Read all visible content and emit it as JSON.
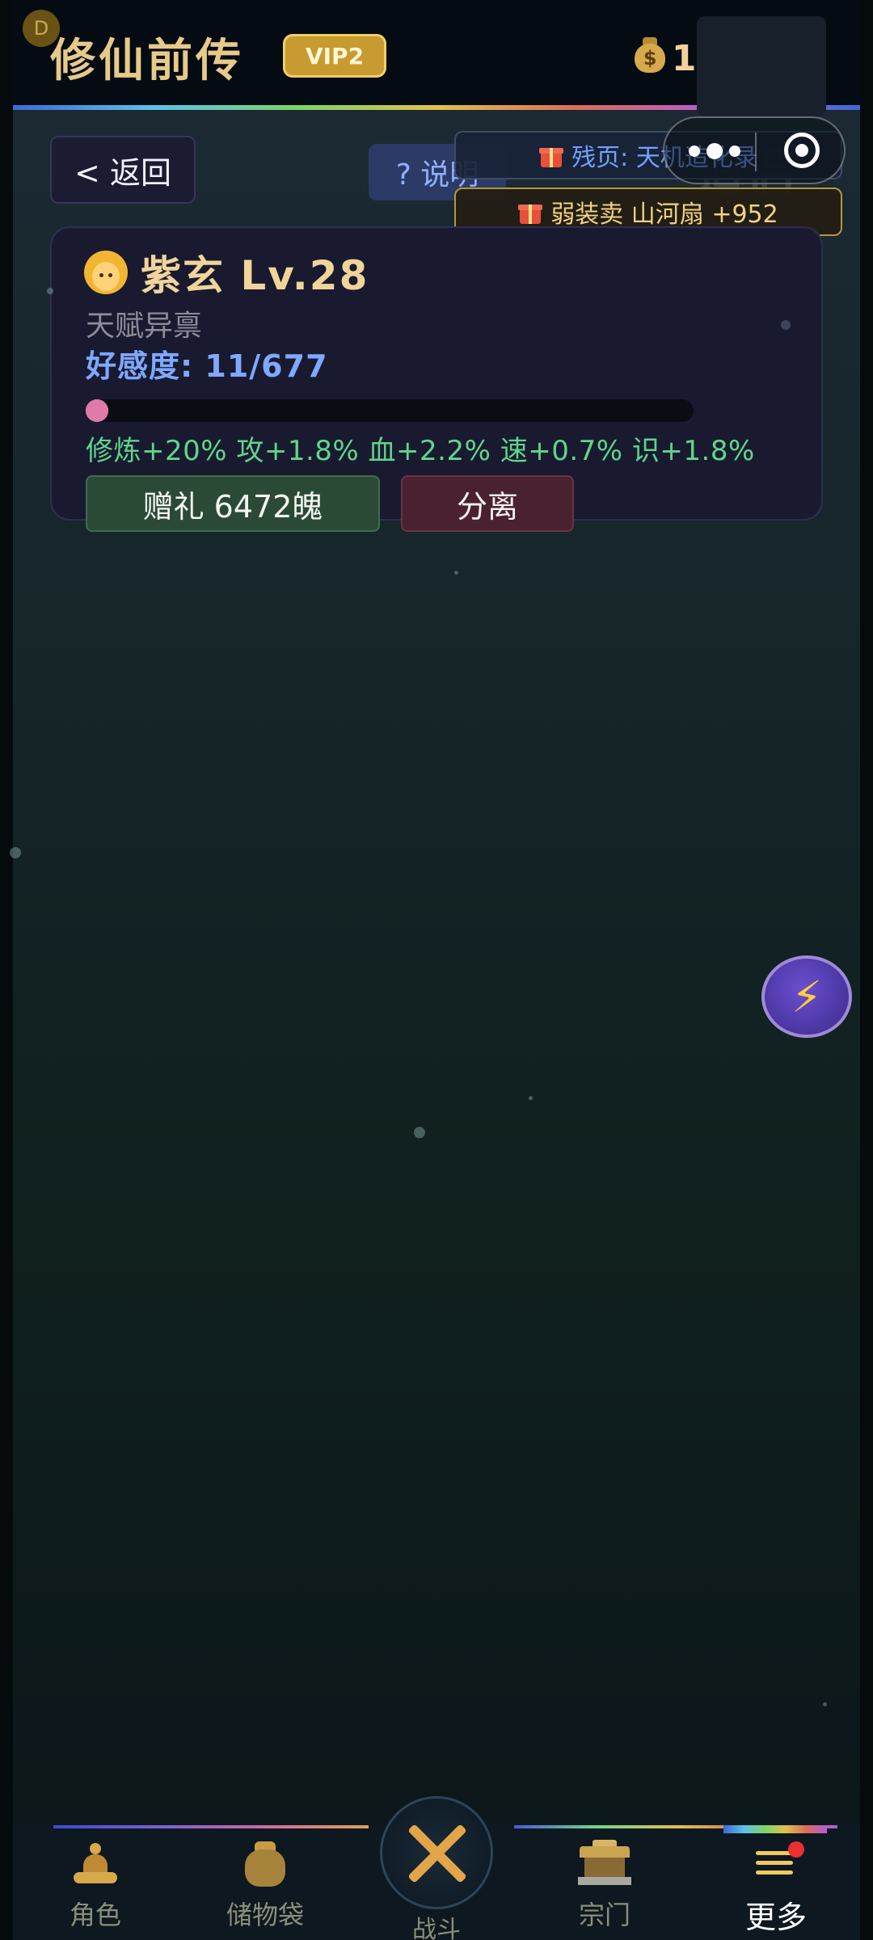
{
  "header": {
    "badge_letter": "D",
    "title": "修仙前传",
    "vip": "VIP2",
    "currency_amount": "183.2万",
    "currency_icon": "money-bag-icon"
  },
  "toolbar": {
    "back_label": "< 返回",
    "help_label": "? 说明",
    "ghost_title": "道侣"
  },
  "tickers": [
    {
      "text": "残页: 天机造化录",
      "color": "#6fa2ff"
    },
    {
      "text": "弱装卖 山河扇 +952",
      "color": "#f3d27f"
    }
  ],
  "companion": {
    "name": "紫玄 Lv.28",
    "talent": "天赋异禀",
    "affinity": "好感度: 11/677",
    "affinity_current": 11,
    "affinity_max": 677,
    "bonuses": "修炼+20% 攻+1.8% 血+2.2% 速+0.7% 识+1.8%",
    "gift_label": "赠礼 6472魄",
    "split_label": "分离"
  },
  "float_button": {
    "icon": "lightning-icon",
    "glyph": "⚡"
  },
  "bottom_nav": {
    "items": [
      {
        "label": "角色",
        "icon": "meditating-figure-icon"
      },
      {
        "label": "储物袋",
        "icon": "storage-bag-icon"
      },
      {
        "label": "战斗",
        "icon": "crossed-swords-icon"
      },
      {
        "label": "宗门",
        "icon": "temple-icon"
      },
      {
        "label": "更多",
        "icon": "menu-icon",
        "active": true
      }
    ]
  },
  "colors": {
    "accent_gold": "#e7c98a",
    "affinity_blue": "#7fa8ff",
    "bonus_green": "#5fd68a",
    "progress_pink": "#e07aa8"
  }
}
